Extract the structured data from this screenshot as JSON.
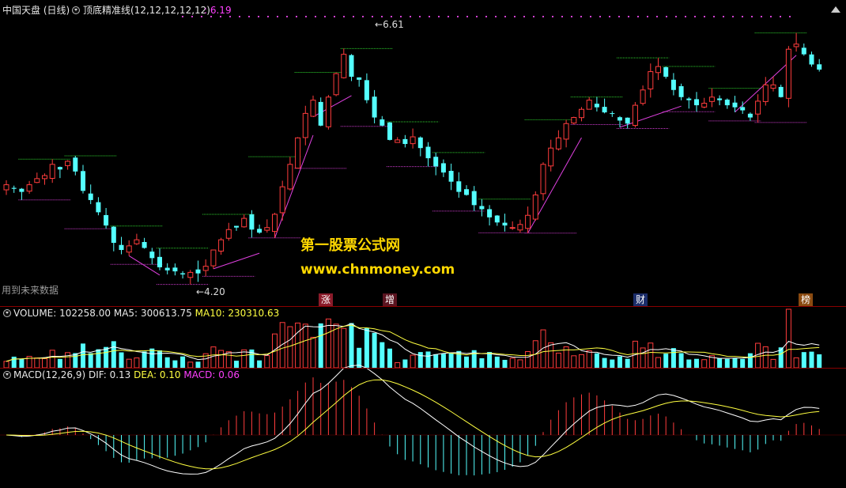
{
  "header": {
    "title": "中国天盘 (日线)",
    "indicator": "顶底精准线(12,12,12,12,12)",
    "indicator_value": ": 6.19"
  },
  "price_chart": {
    "high_label": "6.61",
    "low_label": "4.20",
    "future_note": "用到未来数据",
    "colors": {
      "up": "#ff3c3c",
      "down": "#54ffff",
      "resistance": "#2fd42f",
      "support": "#d03cd0",
      "trend": "#e040e0"
    }
  },
  "event_tags": [
    {
      "label": "涨",
      "bg": "#8a1b2a"
    },
    {
      "label": "增",
      "bg": "#5a1420"
    },
    {
      "label": "财",
      "bg": "#1b2d6a"
    },
    {
      "label": "榜",
      "bg": "#8a4a10"
    }
  ],
  "volume_panel": {
    "name": "VOLUME:",
    "value": "102258.00",
    "ma5_label": "MA5:",
    "ma5": "300613.75",
    "ma10_label": "MA10:",
    "ma10": "230310.63"
  },
  "macd_panel": {
    "name": "MACD(12,26,9)",
    "dif_label": "DIF:",
    "dif": "0.13",
    "dea_label": "DEA:",
    "dea": "0.10",
    "macd_label": "MACD:",
    "macd": "0.06"
  },
  "watermark": {
    "line1": "第一股票公式网",
    "line2": "www.chnmoney.com"
  },
  "chart_data": {
    "type": "candlestick",
    "title": "",
    "closes": [
      5.12,
      5.08,
      5.05,
      5.12,
      5.18,
      5.21,
      5.32,
      5.27,
      5.35,
      5.25,
      5.06,
      4.97,
      4.85,
      4.72,
      4.55,
      4.48,
      4.52,
      4.58,
      4.5,
      4.4,
      4.31,
      4.28,
      4.27,
      4.24,
      4.26,
      4.25,
      4.32,
      4.48,
      4.58,
      4.68,
      4.7,
      4.79,
      4.68,
      4.65,
      4.7,
      4.83,
      5.1,
      5.32,
      5.58,
      5.82,
      5.95,
      5.7,
      5.98,
      6.21,
      6.4,
      6.18,
      6.15,
      5.95,
      5.78,
      5.7,
      5.56,
      5.56,
      5.52,
      5.59,
      5.48,
      5.38,
      5.3,
      5.24,
      5.15,
      5.05,
      5.02,
      4.92,
      4.88,
      4.8,
      4.75,
      4.72,
      4.7,
      4.73,
      4.82,
      5.02,
      5.32,
      5.48,
      5.58,
      5.72,
      5.78,
      5.86,
      5.95,
      5.88,
      5.83,
      5.82,
      5.75,
      5.72,
      5.9,
      6.05,
      6.23,
      6.28,
      6.18,
      6.05,
      5.98,
      5.95,
      5.9,
      5.92,
      5.98,
      5.95,
      5.9,
      5.88,
      5.85,
      5.78,
      5.94,
      6.1,
      6.1,
      5.98,
      6.45,
      6.5,
      6.4,
      6.3,
      6.25
    ],
    "price_range": [
      4.1,
      6.7
    ],
    "volume_range": [
      0,
      1200000
    ],
    "macd_range": [
      -0.3,
      0.3
    ],
    "max_price": 6.61,
    "min_price": 4.2
  }
}
